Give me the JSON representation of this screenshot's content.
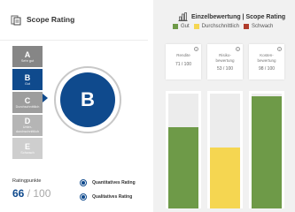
{
  "header": {
    "title": "Scope Rating",
    "icon": "document-icon"
  },
  "rating_scale": [
    {
      "letter": "A",
      "sub": "Sehr gut"
    },
    {
      "letter": "B",
      "sub": "Gut"
    },
    {
      "letter": "C",
      "sub": "Durchschnittlich"
    },
    {
      "letter": "D",
      "sub": "Unter-\ndurchschnittlich"
    },
    {
      "letter": "E",
      "sub": "Schwach"
    }
  ],
  "selected_rating": "B",
  "points": {
    "label": "Ratingpunkte",
    "value": "66",
    "max": "/ 100"
  },
  "rating_modes": [
    {
      "label": "Quantitatives Rating"
    },
    {
      "label": "Qualitatives Rating"
    }
  ],
  "single_rating": {
    "title": "Einzelbewertung | Scope Rating",
    "icon": "bar-chart-icon",
    "legend": [
      {
        "label": "Gut",
        "color": "#6e9a48"
      },
      {
        "label": "Durchschnittlich",
        "color": "#f5d651"
      },
      {
        "label": "Schwach",
        "color": "#b03c2c"
      }
    ],
    "cards": [
      {
        "title": "Rendite",
        "value": "71 / 100",
        "score": 71,
        "color": "#6e9a48"
      },
      {
        "title": "Risiko-\nbewertung",
        "value": "53 / 100",
        "score": 53,
        "color": "#f5d651"
      },
      {
        "title": "Kosten-\nbewertung",
        "value": "98 / 100",
        "score": 98,
        "color": "#6e9a48"
      }
    ]
  },
  "colors": {
    "accent": "#0f4a8d"
  }
}
